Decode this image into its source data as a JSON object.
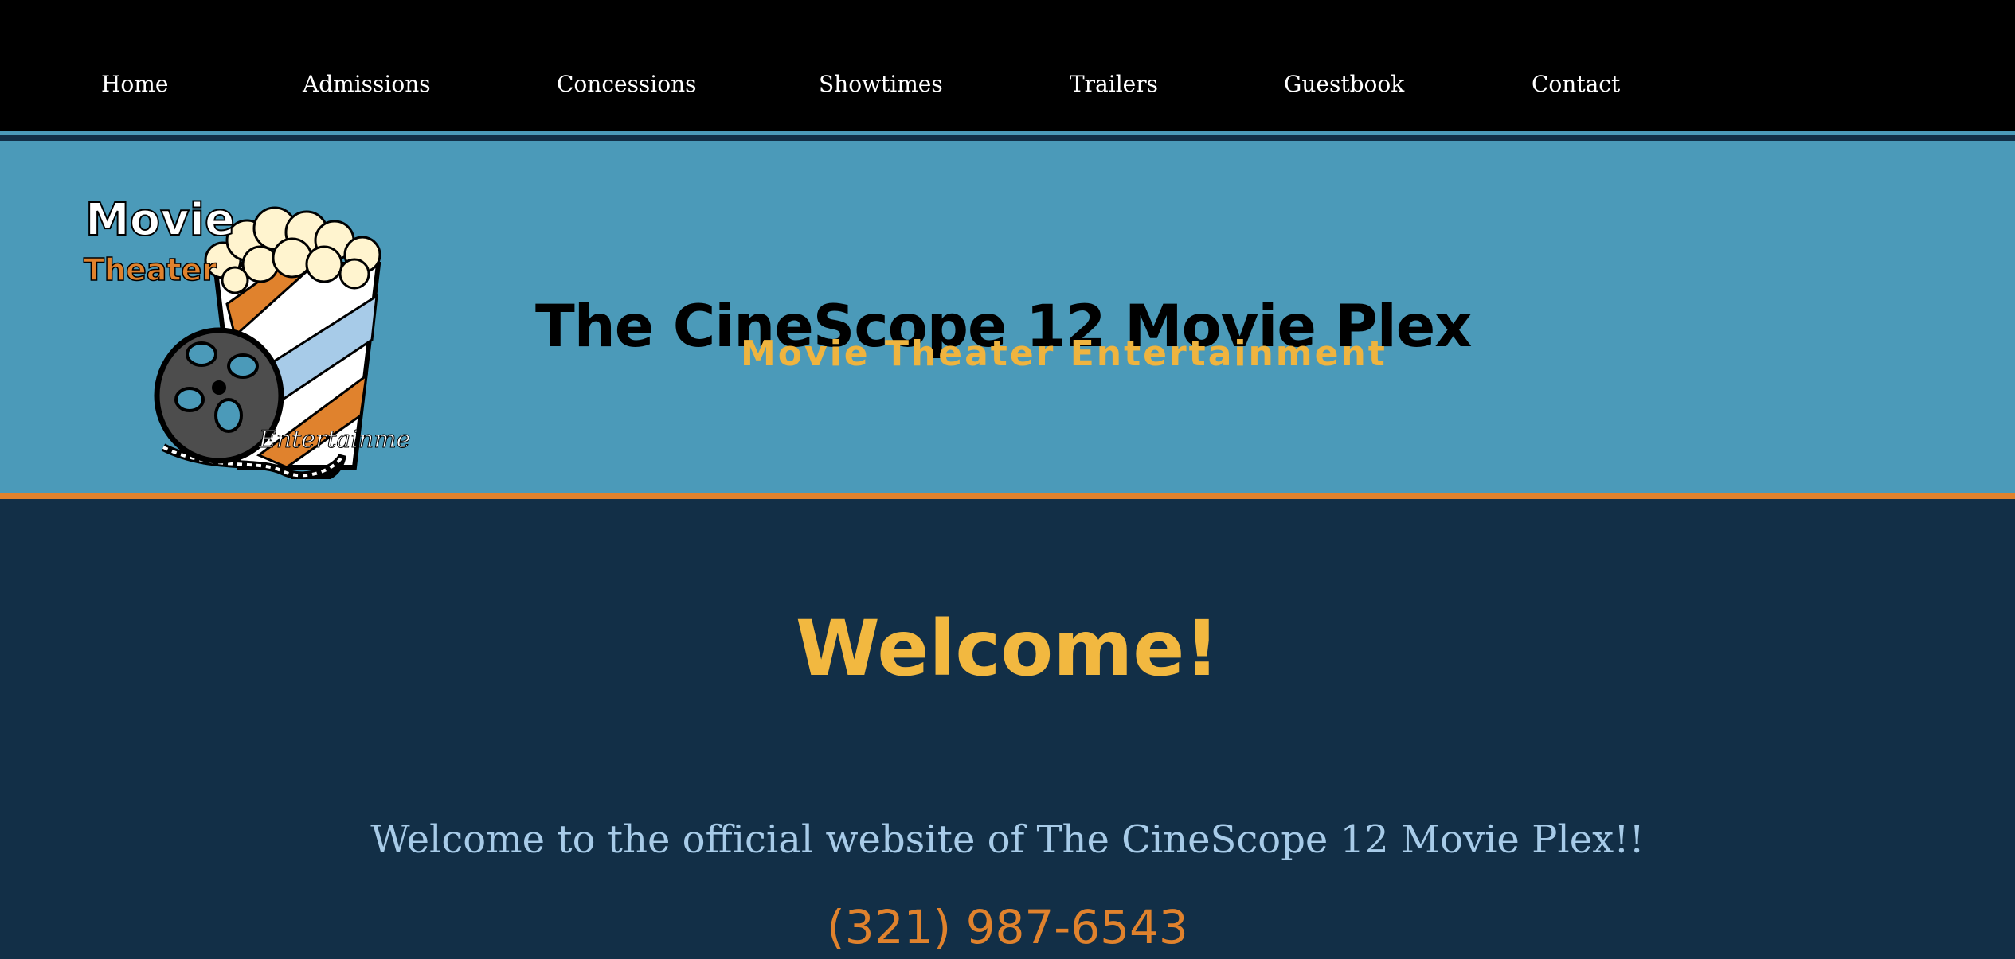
{
  "nav": {
    "items": [
      {
        "label": "Home"
      },
      {
        "label": "Admissions"
      },
      {
        "label": "Concessions"
      },
      {
        "label": "Showtimes"
      },
      {
        "label": "Trailers"
      },
      {
        "label": "Guestbook"
      },
      {
        "label": "Contact"
      }
    ]
  },
  "header": {
    "logo": {
      "word1": "Movie",
      "word2": "Theater",
      "word3": "Entertainment"
    },
    "title": "The CineScope 12 Movie Plex",
    "tagline": "Movie Theater Entertainment"
  },
  "main": {
    "heading": "Welcome!",
    "intro": "Welcome to the official website of The CineScope 12 Movie Plex!!",
    "phone": "(321) 987-6543"
  },
  "colors": {
    "nav_bg": "#000000",
    "header_bg": "#4b9ab9",
    "header_border": "#e0822d",
    "body_bg": "#122f47",
    "accent_yellow": "#f2b840",
    "accent_orange": "#e0822d",
    "light_blue_text": "#a7cbe8"
  },
  "icons": {
    "logo": "popcorn-film-reel-logo"
  }
}
